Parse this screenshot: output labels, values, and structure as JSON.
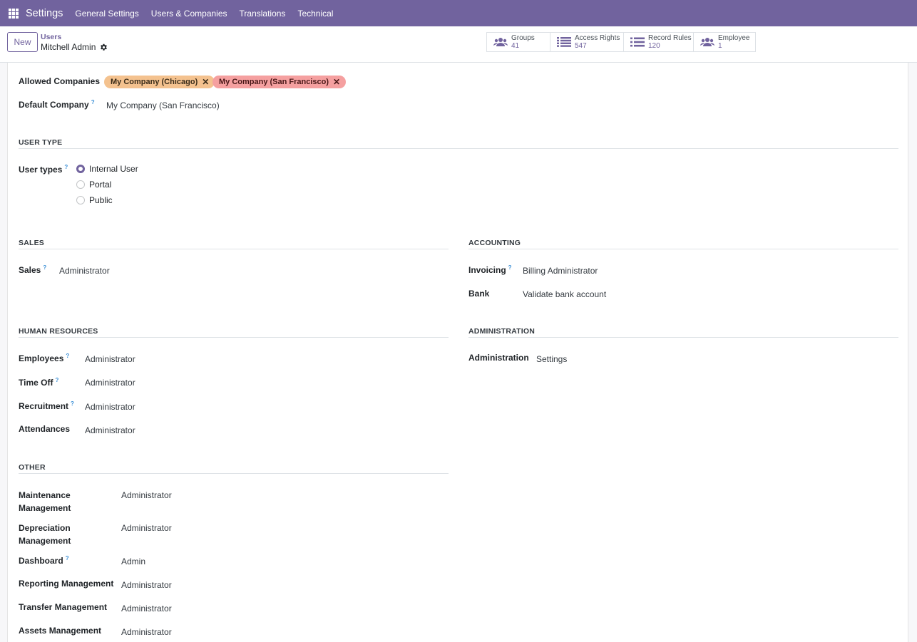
{
  "navbar": {
    "brand": "Settings",
    "menu": [
      "General Settings",
      "Users & Companies",
      "Translations",
      "Technical"
    ]
  },
  "control": {
    "new_label": "New",
    "breadcrumb_parent": "Users",
    "breadcrumb_current": "Mitchell Admin",
    "smart_buttons": [
      {
        "label": "Groups",
        "value": "41",
        "icon": "users-icon"
      },
      {
        "label": "Access Rights",
        "value": "547",
        "icon": "list-icon"
      },
      {
        "label": "Record Rules",
        "value": "120",
        "icon": "list-icon"
      },
      {
        "label": "Employee",
        "value": "1",
        "icon": "users-icon"
      }
    ]
  },
  "companies": {
    "allowed_label": "Allowed Companies",
    "tags": [
      "My Company (Chicago)",
      "My Company (San Francisco)"
    ],
    "default_label": "Default Company",
    "default_value": "My Company (San Francisco)",
    "help_mark": "?"
  },
  "user_type": {
    "title": "USER TYPE",
    "label": "User types",
    "options": [
      "Internal User",
      "Portal",
      "Public"
    ],
    "selected": "Internal User"
  },
  "sales": {
    "title": "SALES",
    "fields": [
      {
        "label": "Sales",
        "value": "Administrator",
        "help": true
      }
    ]
  },
  "accounting": {
    "title": "ACCOUNTING",
    "fields": [
      {
        "label": "Invoicing",
        "value": "Billing Administrator",
        "help": true
      },
      {
        "label": "Bank",
        "value": "Validate bank account",
        "help": false
      }
    ]
  },
  "hr": {
    "title": "HUMAN RESOURCES",
    "fields": [
      {
        "label": "Employees",
        "value": "Administrator",
        "help": true
      },
      {
        "label": "Time Off",
        "value": "Administrator",
        "help": true
      },
      {
        "label": "Recruitment",
        "value": "Administrator",
        "help": true
      },
      {
        "label": "Attendances",
        "value": "Administrator",
        "help": false
      }
    ]
  },
  "administration": {
    "title": "ADMINISTRATION",
    "fields": [
      {
        "label": "Administration",
        "value": "Settings",
        "help": false
      }
    ]
  },
  "other": {
    "title": "OTHER",
    "fields": [
      {
        "label_line1": "Maintenance",
        "label_line2": "Management",
        "value": "Administrator"
      },
      {
        "label_line1": "Depreciation",
        "label_line2": "Management",
        "value": "Administrator"
      },
      {
        "label_line1": "Dashboard",
        "label_line2": "",
        "value": "Admin",
        "help": true
      },
      {
        "label_line1": "Reporting Management",
        "label_line2": "",
        "value": "Administrator"
      },
      {
        "label_line1": "Transfer Management",
        "label_line2": "",
        "value": "Administrator"
      },
      {
        "label_line1": "Assets Management",
        "label_line2": "",
        "value": "Administrator"
      }
    ]
  },
  "colors": {
    "brand": "#71639e",
    "help": "#3a8fd6",
    "tag_chicago": "#f4c28f",
    "tag_sf": "#f5a0a0"
  }
}
